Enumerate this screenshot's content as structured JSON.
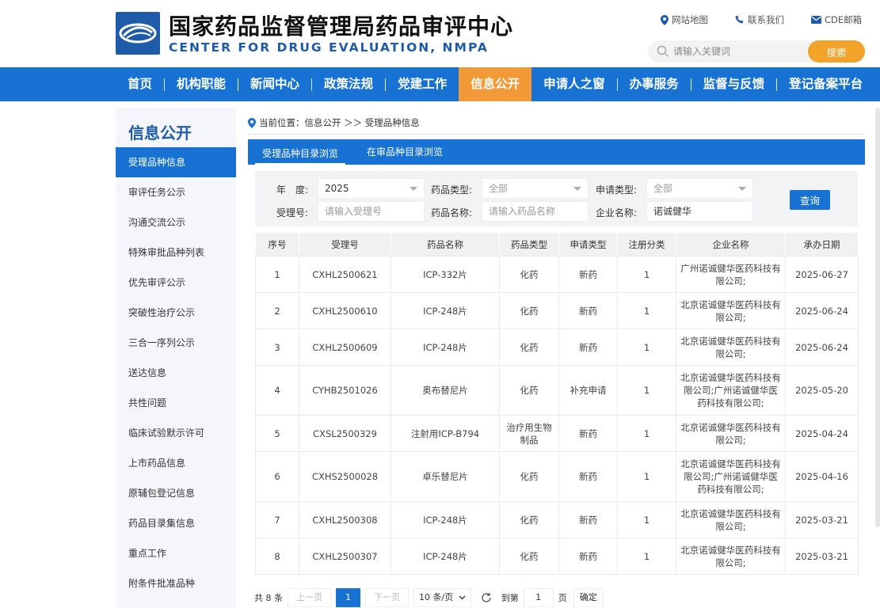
{
  "header": {
    "title": "国家药品监督管理局药品审评中心",
    "subtitle": "CENTER FOR DRUG EVALUATION, NMPA",
    "links": [
      "网站地图",
      "联系我们",
      "CDE邮箱"
    ],
    "search_placeholder": "请输入关键词",
    "search_button": "搜索"
  },
  "nav": {
    "items": [
      "首页",
      "机构职能",
      "新闻中心",
      "政策法规",
      "党建工作",
      "信息公开",
      "申请人之窗",
      "办事服务",
      "监督与反馈",
      "登记备案平台"
    ],
    "active": "信息公开"
  },
  "sidebar": {
    "title": "信息公开",
    "items": [
      "受理品种信息",
      "审评任务公示",
      "沟通交流公示",
      "特殊审批品种列表",
      "优先审评公示",
      "突破性治疗公示",
      "三合一序列公示",
      "送达信息",
      "共性问题",
      "临床试验默示许可",
      "上市药品信息",
      "原辅包登记信息",
      "药品目录集信息",
      "重点工作",
      "附条件批准品种"
    ]
  },
  "breadcrumb": "当前位置：信息公开 ＞＞ 受理品种信息",
  "tabs": [
    "受理品种目录浏览",
    "在审品种目录浏览"
  ],
  "filters": {
    "year_label": "年　度:",
    "year_value": "2025",
    "drug_type_label": "药品类型:",
    "drug_type_value": "全部",
    "apply_type_label": "申请类型:",
    "apply_type_value": "全部",
    "accept_no_label": "受理号:",
    "accept_no_placeholder": "请输入受理号",
    "drug_name_label": "药品名称:",
    "drug_name_placeholder": "请输入药品名称",
    "company_label": "企业名称:",
    "company_value": "诺诚健华",
    "query_button": "查询"
  },
  "table": {
    "headers": [
      "序号",
      "受理号",
      "药品名称",
      "药品类型",
      "申请类型",
      "注册分类",
      "企业名称",
      "承办日期"
    ],
    "rows": [
      [
        "1",
        "CXHL2500621",
        "ICP-332片",
        "化药",
        "新药",
        "1",
        "广州诺诚健华医药科技有限公司;",
        "2025-06-27"
      ],
      [
        "2",
        "CXHL2500610",
        "ICP-248片",
        "化药",
        "新药",
        "1",
        "北京诺诚健华医药科技有限公司;",
        "2025-06-24"
      ],
      [
        "3",
        "CXHL2500609",
        "ICP-248片",
        "化药",
        "新药",
        "1",
        "北京诺诚健华医药科技有限公司;",
        "2025-06-24"
      ],
      [
        "4",
        "CYHB2501026",
        "奥布替尼片",
        "化药",
        "补充申请",
        "1",
        "北京诺诚健华医药科技有限公司;广州诺诚健华医药科技有限公司;",
        "2025-05-20"
      ],
      [
        "5",
        "CXSL2500329",
        "注射用ICP-B794",
        "治疗用生物制品",
        "新药",
        "1",
        "北京诺诚健华医药科技有限公司;",
        "2025-04-24"
      ],
      [
        "6",
        "CXHS2500028",
        "卓乐替尼片",
        "化药",
        "新药",
        "1",
        "北京诺诚健华医药科技有限公司;广州诺诚健华医药科技有限公司;",
        "2025-04-16"
      ],
      [
        "7",
        "CXHL2500308",
        "ICP-248片",
        "化药",
        "新药",
        "1",
        "北京诺诚健华医药科技有限公司;",
        "2025-03-21"
      ],
      [
        "8",
        "CXHL2500307",
        "ICP-248片",
        "化药",
        "新药",
        "1",
        "北京诺诚健华医药科技有限公司;",
        "2025-03-21"
      ]
    ]
  },
  "pager": {
    "total": "共 8 条",
    "prev": "上一页",
    "current": "1",
    "next": "下一页",
    "page_size": "10 条/页",
    "goto_label": "到第",
    "goto_value": "1",
    "page_unit": "页",
    "confirm": "确定"
  }
}
